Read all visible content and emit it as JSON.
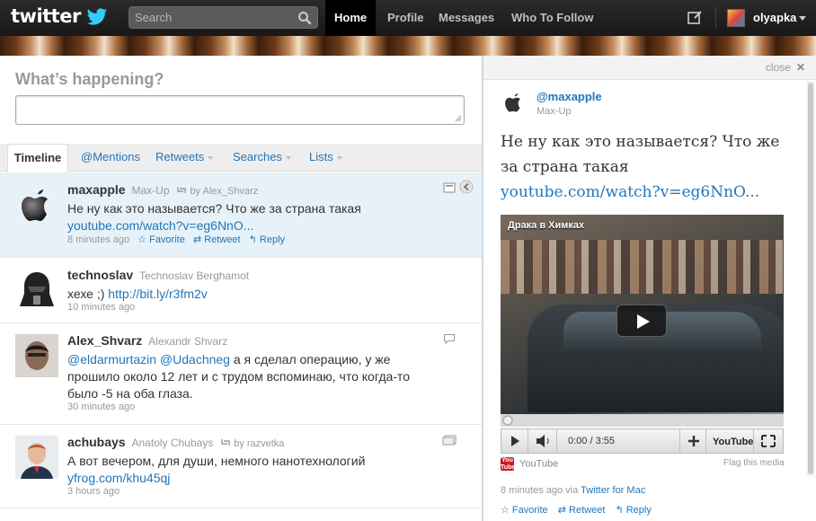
{
  "topbar": {
    "logo": "twitter",
    "search_placeholder": "Search",
    "nav": [
      "Home",
      "Profile",
      "Messages",
      "Who To Follow"
    ],
    "username": "olyapka"
  },
  "compose": {
    "prompt": "What’s happening?"
  },
  "tabs": [
    {
      "label": "Timeline",
      "active": true
    },
    {
      "label": "@Mentions"
    },
    {
      "label": "Retweets"
    },
    {
      "label": "Searches"
    },
    {
      "label": "Lists"
    }
  ],
  "tweets": [
    {
      "user": "maxapple",
      "name": "Max-Up",
      "retweet_by": "by Alex_Shvarz",
      "text": "Не ну как это называется? Что же за страна такая",
      "link": "youtube.com/watch?v=eg6NnO...",
      "time": "8 minutes ago",
      "actions": [
        "Favorite",
        "Retweet",
        "Reply"
      ]
    },
    {
      "user": "technoslav",
      "name": "Technoslav Berghamot",
      "text": "хехе ;)",
      "link": "http://bit.ly/r3fm2v",
      "time": "10 minutes ago"
    },
    {
      "user": "Alex_Shvarz",
      "name": "Alexandr Shvarz",
      "mention1": "@eldarmurtazin",
      "mention2": "@Udachneg",
      "text": "а я сделал операцию, у же прошило около 12 лет и с трудом вспоминаю, что когда-то было -5 на оба глаза.",
      "time": "30 minutes ago"
    },
    {
      "user": "achubays",
      "name": "Anatoly Chubays",
      "retweet_by": "by razvetka",
      "text": "А вот вечером, для души, немного нанотехнологий",
      "link": "yfrog.com/khu45qj",
      "time": "3 hours ago"
    }
  ],
  "detail": {
    "close": "close",
    "user": "@maxapple",
    "name": "Max-Up",
    "text": "Не ну как это называется? Что же за страна такая",
    "link": "youtube.com/watch?v=eg6NnO...",
    "video_title": "Драка в Химках",
    "video_time": "0:00 / 3:55",
    "video_progress": 0,
    "yt_icon_text": "You Tube",
    "yt_brand_text": "YouTube",
    "source": "YouTube",
    "flag": "Flag this media",
    "time": "8 minutes ago via",
    "client": "Twitter for Mac",
    "actions": [
      "Favorite",
      "Retweet",
      "Reply"
    ]
  },
  "colors": {
    "link": "#2276bb",
    "topbar": "#1f1f1f",
    "selected_row": "#e6f2f8"
  }
}
